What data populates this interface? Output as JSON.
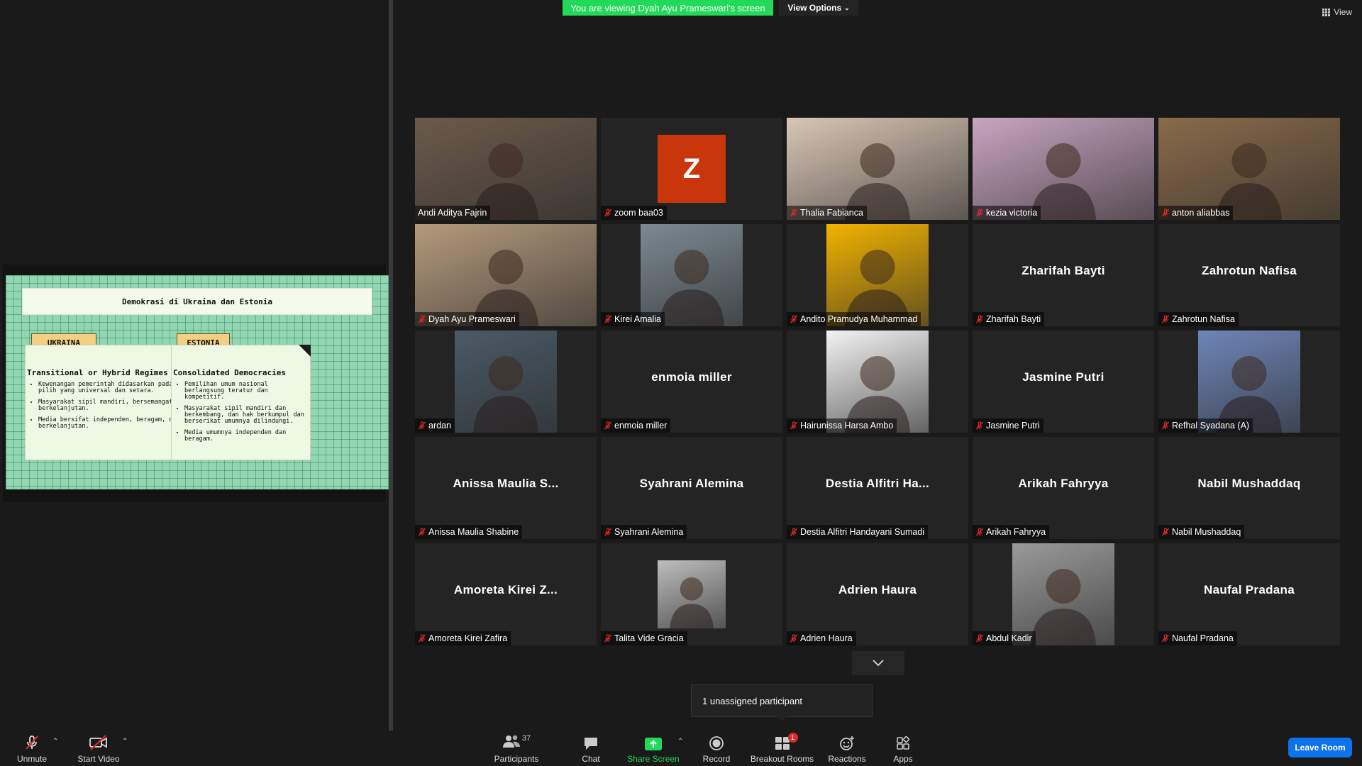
{
  "banner": {
    "text": "You are viewing Dyah Ayu Prameswari's screen",
    "view_options": "View Options"
  },
  "view_label": "View",
  "slide": {
    "title": "Demokrasi di Ukraina dan Estonia",
    "left": {
      "tag": "UKRAINA",
      "heading": "Transitional or Hybrid Regimes",
      "bullets": [
        "Kewenangan pemerintah didasarkan pada hak pilih yang universal dan setara.",
        "Masyarakat sipil mandiri, bersemangat, dan berkelanjutan.",
        "Media bersifat independen, beragam, dan berkelanjutan."
      ]
    },
    "right": {
      "tag": "ESTONIA",
      "heading": "Consolidated Democracies",
      "bullets": [
        "Pemilihan umum nasional berlangsung teratur dan kompetitif.",
        "Masyarakat sipil mandiri dan berkembang, dan hak berkumpul dan berserikat umumnya dilindungi.",
        "Media umumnya independen dan beragam."
      ]
    }
  },
  "participants": [
    {
      "label": "Andi Aditya Fajrin",
      "display": "",
      "video": true,
      "muted": false,
      "active": true,
      "bg": "#6b5a4a"
    },
    {
      "label": "zoom baa03",
      "display": "",
      "avatar_letter": "Z",
      "muted": true
    },
    {
      "label": "Thalia Fabianca",
      "display": "",
      "video": true,
      "muted": true,
      "bg": "#d9c6b4"
    },
    {
      "label": "kezia victoria",
      "display": "",
      "video": true,
      "muted": true,
      "bg": "#c9a5c0"
    },
    {
      "label": "anton aliabbas",
      "display": "",
      "video": true,
      "muted": true,
      "bg": "#8a6a4a"
    },
    {
      "label": "Dyah Ayu Prameswari",
      "display": "",
      "video": true,
      "muted": true,
      "bg": "#b59a7c"
    },
    {
      "label": "Kirei Amalia",
      "display": "",
      "video": true,
      "narrow": true,
      "muted": true,
      "bg": "#7c8a93"
    },
    {
      "label": "Andito Pramudya Muhammad",
      "display": "",
      "video": true,
      "narrow": true,
      "muted": true,
      "bg": "#f2b300"
    },
    {
      "label": "Zharifah Bayti",
      "display": "Zharifah Bayti",
      "muted": true
    },
    {
      "label": "Zahrotun Nafisa",
      "display": "Zahrotun Nafisa",
      "muted": true
    },
    {
      "label": "ardan",
      "display": "",
      "video": true,
      "narrow": true,
      "muted": true,
      "bg": "#4a5a66"
    },
    {
      "label": "enmoia miller",
      "display": "enmoia miller",
      "muted": true
    },
    {
      "label": "Hairunissa Harsa Ambo",
      "display": "",
      "video": true,
      "narrow": true,
      "muted": true,
      "bg": "#f3f3f3"
    },
    {
      "label": "Jasmine Putri",
      "display": "Jasmine Putri",
      "muted": true
    },
    {
      "label": "Refhal Syadana (A)",
      "display": "",
      "video": true,
      "narrow": true,
      "muted": true,
      "bg": "#6e86b8"
    },
    {
      "label": "Anissa Maulia Shabine",
      "display": "Anissa Maulia S...",
      "muted": true
    },
    {
      "label": "Syahrani Alemina",
      "display": "Syahrani Alemina",
      "muted": true
    },
    {
      "label": "Destia Alfitri Handayani Sumadi",
      "display": "Destia Alfitri Ha...",
      "muted": true
    },
    {
      "label": "Arikah Fahryya",
      "display": "Arikah Fahryya",
      "muted": true
    },
    {
      "label": "Nabil Mushaddaq",
      "display": "Nabil Mushaddaq",
      "muted": true
    },
    {
      "label": "Amoreta Kirei Zafira",
      "display": "Amoreta Kirei Z...",
      "muted": true
    },
    {
      "label": "Talita Vide Gracia",
      "display": "",
      "video": true,
      "small": true,
      "muted": true,
      "bg": "#bdbdbd"
    },
    {
      "label": "Adrien Haura",
      "display": "Adrien Haura",
      "muted": true
    },
    {
      "label": "Abdul Kadir",
      "display": "",
      "video": true,
      "narrow": true,
      "muted": true,
      "bg": "#9a9a9a"
    },
    {
      "label": "Naufal Pradana",
      "display": "Naufal Pradana",
      "muted": true
    }
  ],
  "unassigned": "1 unassigned participant",
  "toolbar": {
    "unmute": "Unmute",
    "start_video": "Start Video",
    "participants": "Participants",
    "participant_count": "37",
    "chat": "Chat",
    "share_screen": "Share Screen",
    "record": "Record",
    "breakout": "Breakout Rooms",
    "breakout_badge": "1",
    "reactions": "Reactions",
    "apps": "Apps",
    "leave": "Leave Room"
  },
  "colors": {
    "banner_green": "#23d959",
    "leave_blue": "#0e72ed",
    "active_outline": "#e8e21b",
    "mute_red": "#e02828"
  }
}
